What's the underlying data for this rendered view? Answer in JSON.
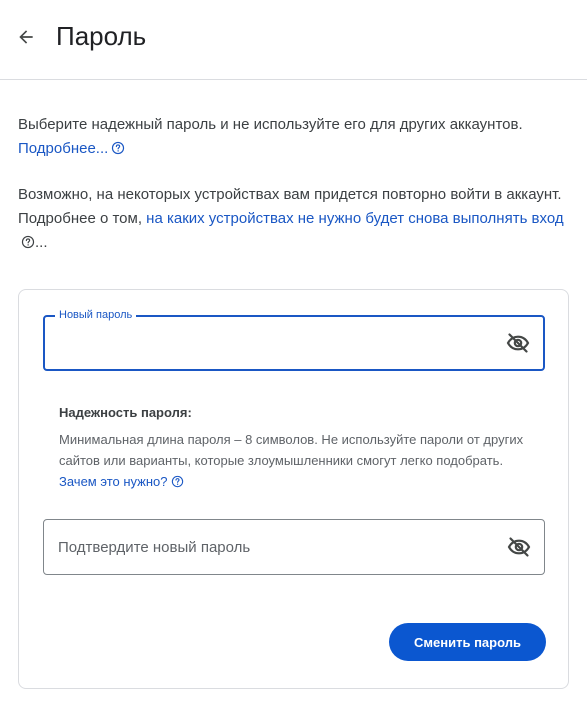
{
  "header": {
    "title": "Пароль",
    "back_icon": "arrow-back-icon"
  },
  "intro": {
    "p1_text": "Выберите надежный пароль и не используйте его для других аккаунтов.",
    "p1_link": "Подробнее...",
    "p2_text": "Возможно, на некоторых устройствах вам придется повторно войти в аккаунт. Подробнее о том, ",
    "p2_link": "на каких устройствах не нужно будет снова выполнять вход",
    "p2_suffix": "..."
  },
  "form": {
    "new_password": {
      "label": "Новый пароль",
      "value": "",
      "placeholder": ""
    },
    "strength": {
      "title": "Надежность пароля:",
      "text": "Минимальная длина пароля – 8 символов. Не используйте пароли от других сайтов или варианты, которые злоумышленники смогут легко подобрать. ",
      "link": "Зачем это нужно?"
    },
    "confirm_password": {
      "placeholder": "Подтвердите новый пароль",
      "value": ""
    },
    "submit_label": "Сменить пароль"
  },
  "colors": {
    "accent": "#0b57d0",
    "link": "#1a57c4",
    "border": "#dadce0",
    "text": "#202124",
    "muted": "#5f6368"
  }
}
